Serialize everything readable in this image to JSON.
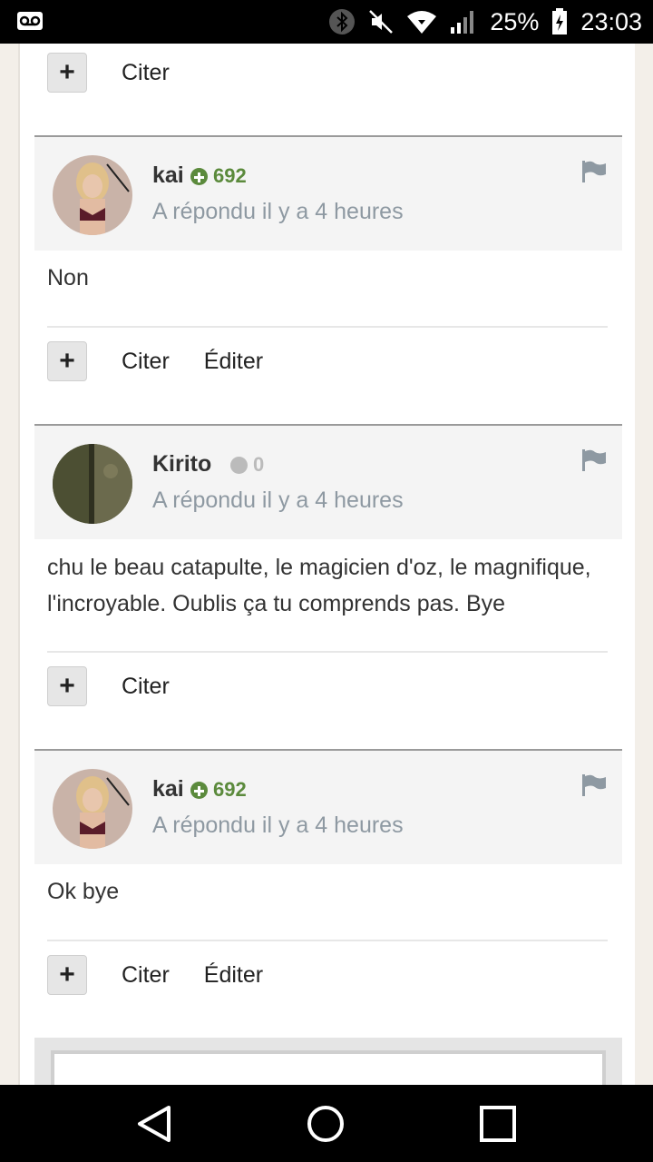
{
  "status_bar": {
    "battery": "25%",
    "time": "23:03",
    "icons": [
      "voicemail-icon",
      "bluetooth-icon",
      "mute-icon",
      "wifi-icon",
      "signal-icon",
      "battery-icon"
    ]
  },
  "actions": {
    "plus": "+",
    "quote": "Citer",
    "edit": "Éditer"
  },
  "posts": [
    {
      "username": "kai",
      "reputation": "692",
      "reputation_color": "#5b8a3c",
      "meta": "A répondu il y a 4 heures",
      "body": "Non",
      "can_edit": true
    },
    {
      "username": "Kirito",
      "reputation": "0",
      "reputation_color": "#bbbbbb",
      "meta": "A répondu il y a 4 heures",
      "body": "chu le beau catapulte, le magicien d'oz, le magnifique, l'incroyable. Oublis ça tu comprends pas. Bye",
      "can_edit": false
    },
    {
      "username": "kai",
      "reputation": "692",
      "reputation_color": "#5b8a3c",
      "meta": "A répondu il y a 4 heures",
      "body": "Ok bye",
      "can_edit": true
    }
  ],
  "nav": [
    "back-icon",
    "home-icon",
    "recents-icon"
  ]
}
